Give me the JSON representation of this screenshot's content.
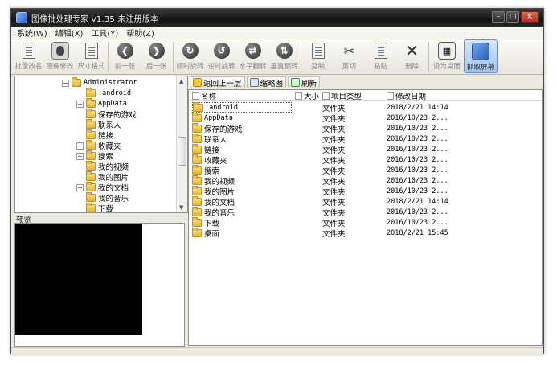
{
  "window": {
    "title": "图像批处理专家 v1.35 未注册版本",
    "controls": {
      "minimize": "–",
      "maximize": "□",
      "close": "×"
    }
  },
  "menu": [
    "系统(W)",
    "编辑(X)",
    "工具(Y)",
    "帮助(Z)"
  ],
  "toolbar": {
    "buttons": [
      {
        "label": "批量改名",
        "icon": "rename-icon",
        "enabled": false
      },
      {
        "label": "图像修改",
        "icon": "photo-edit-icon",
        "enabled": false
      },
      {
        "label": "尺寸格式",
        "icon": "resize-icon",
        "enabled": false
      },
      {
        "label": "前一张",
        "icon": "prev-arrow-icon",
        "enabled": false
      },
      {
        "label": "后一张",
        "icon": "next-arrow-icon",
        "enabled": false
      },
      {
        "label": "顺时旋转",
        "icon": "rotate-cw-icon",
        "enabled": false
      },
      {
        "label": "逆时旋转",
        "icon": "rotate-ccw-icon",
        "enabled": false
      },
      {
        "label": "水平翻转",
        "icon": "flip-horizontal-icon",
        "enabled": false
      },
      {
        "label": "垂直翻转",
        "icon": "flip-vertical-icon",
        "enabled": false
      },
      {
        "label": "复制",
        "icon": "copy-icon",
        "enabled": false
      },
      {
        "label": "剪切",
        "icon": "cut-icon",
        "enabled": false
      },
      {
        "label": "粘贴",
        "icon": "paste-icon",
        "enabled": false
      },
      {
        "label": "删除",
        "icon": "delete-icon",
        "enabled": false
      },
      {
        "label": "设为桌面",
        "icon": "set-desktop-icon",
        "enabled": false
      },
      {
        "label": "抓取屏幕",
        "icon": "capture-screen-icon",
        "enabled": true
      }
    ]
  },
  "tree": {
    "items": [
      {
        "label": "Administrator",
        "expander": "⊟",
        "mono": true
      },
      {
        "label": ".android",
        "expander": "",
        "mono": true
      },
      {
        "label": "AppData",
        "expander": "⊞",
        "mono": true
      },
      {
        "label": "保存的游戏",
        "expander": "",
        "mono": false
      },
      {
        "label": "联系人",
        "expander": "",
        "mono": false
      },
      {
        "label": "链接",
        "expander": "",
        "mono": false
      },
      {
        "label": "收藏夹",
        "expander": "⊞",
        "mono": false
      },
      {
        "label": "搜索",
        "expander": "⊞",
        "mono": false
      },
      {
        "label": "我的视频",
        "expander": "",
        "mono": false
      },
      {
        "label": "我的图片",
        "expander": "",
        "mono": false
      },
      {
        "label": "我的文档",
        "expander": "⊞",
        "mono": false
      },
      {
        "label": "我的音乐",
        "expander": "",
        "mono": false
      },
      {
        "label": "下载",
        "expander": "",
        "mono": false
      }
    ]
  },
  "preview": {
    "label": "预览"
  },
  "nav": {
    "up_label": "返回上一层",
    "thumb_label": "缩略图",
    "refresh_label": "刷新"
  },
  "list": {
    "columns": {
      "name": "名称",
      "size": "大小",
      "type": "项目类型",
      "date": "修改日期"
    },
    "rows": [
      {
        "name": ".android",
        "mono": true,
        "type": "文件夹",
        "date": "2018/2/21 14:14",
        "selected": true
      },
      {
        "name": "AppData",
        "mono": true,
        "type": "文件夹",
        "date": "2016/10/23 2...",
        "selected": false
      },
      {
        "name": "保存的游戏",
        "mono": false,
        "type": "文件夹",
        "date": "2016/10/23 2...",
        "selected": false
      },
      {
        "name": "联系人",
        "mono": false,
        "type": "文件夹",
        "date": "2016/10/23 2...",
        "selected": false
      },
      {
        "name": "链接",
        "mono": false,
        "type": "文件夹",
        "date": "2016/10/23 2...",
        "selected": false
      },
      {
        "name": "收藏夹",
        "mono": false,
        "type": "文件夹",
        "date": "2016/10/23 2...",
        "selected": false
      },
      {
        "name": "搜索",
        "mono": false,
        "type": "文件夹",
        "date": "2016/10/23 2...",
        "selected": false
      },
      {
        "name": "我的视频",
        "mono": false,
        "type": "文件夹",
        "date": "2016/10/23 2...",
        "selected": false
      },
      {
        "name": "我的图片",
        "mono": false,
        "type": "文件夹",
        "date": "2016/10/23 2...",
        "selected": false
      },
      {
        "name": "我的文档",
        "mono": false,
        "type": "文件夹",
        "date": "2018/2/21 14:14",
        "selected": false
      },
      {
        "name": "我的音乐",
        "mono": false,
        "type": "文件夹",
        "date": "2016/10/23 2...",
        "selected": false
      },
      {
        "name": "下载",
        "mono": false,
        "type": "文件夹",
        "date": "2016/10/23 2...",
        "selected": false
      },
      {
        "name": "桌面",
        "mono": false,
        "type": "文件夹",
        "date": "2018/2/21 15:45",
        "selected": false
      }
    ]
  }
}
